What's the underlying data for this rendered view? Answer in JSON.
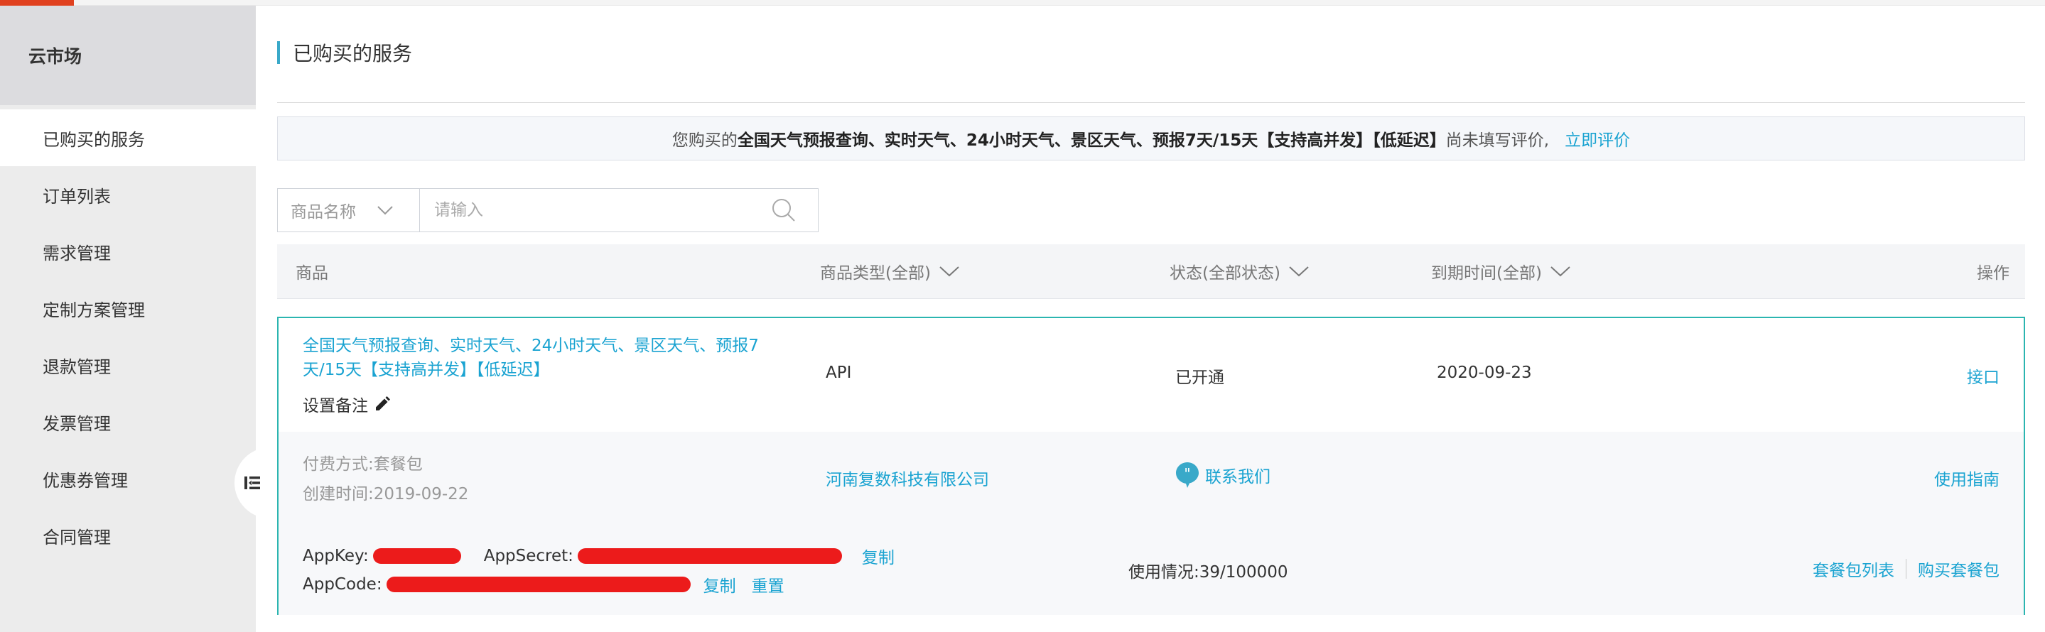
{
  "sidebar": {
    "title": "云市场",
    "items": [
      {
        "label": "已购买的服务",
        "active": true
      },
      {
        "label": "订单列表"
      },
      {
        "label": "需求管理"
      },
      {
        "label": "定制方案管理"
      },
      {
        "label": "退款管理"
      },
      {
        "label": "发票管理"
      },
      {
        "label": "优惠券管理"
      },
      {
        "label": "合同管理"
      }
    ]
  },
  "page": {
    "title": "已购买的服务"
  },
  "notice": {
    "prefix": "您购买的",
    "product": "全国天气预报查询、实时天气、24小时天气、景区天气、预报7天/15天【支持高并发】【低延迟】",
    "suffix": "尚未填写评价,",
    "action": "立即评价"
  },
  "search": {
    "select_value": "商品名称",
    "placeholder": "请输入"
  },
  "table": {
    "columns": {
      "product": "商品",
      "type": "商品类型(全部)",
      "status": "状态(全部状态)",
      "expiry": "到期时间(全部)",
      "action": "操作"
    }
  },
  "order": {
    "product_name": "全国天气预报查询、实时天气、24小时天气、景区天气、预报7天/15天【支持高并发】【低延迟】",
    "remark_label": "设置备注",
    "type": "API",
    "status": "已开通",
    "expiry": "2020-09-23",
    "action": "接口",
    "pay_method_label": "付费方式:",
    "pay_method": "套餐包",
    "created_label": "创建时间:",
    "created": "2019-09-22",
    "vendor": "河南复数科技有限公司",
    "contact": "联系我们",
    "guide": "使用指南",
    "appkey_label": "AppKey:",
    "appsecret_label": "AppSecret:",
    "appcode_label": "AppCode:",
    "copy": "复制",
    "copy2": "复制",
    "reset": "重置",
    "usage_label": "使用情况:",
    "usage": "39/100000",
    "package_list": "套餐包列表",
    "buy_package": "购买套餐包"
  },
  "colors": {
    "accent": "#1aa3d1",
    "card_border": "#2bb5b0",
    "redaction": "#ec1b1b",
    "brand_top": "#e0411f"
  },
  "icons": {
    "select_chevron": "chevron-down-icon",
    "search": "search-icon",
    "edit": "pencil-icon",
    "contact": "chat-bubble-icon",
    "collapse": "collapse-sidebar-icon"
  }
}
